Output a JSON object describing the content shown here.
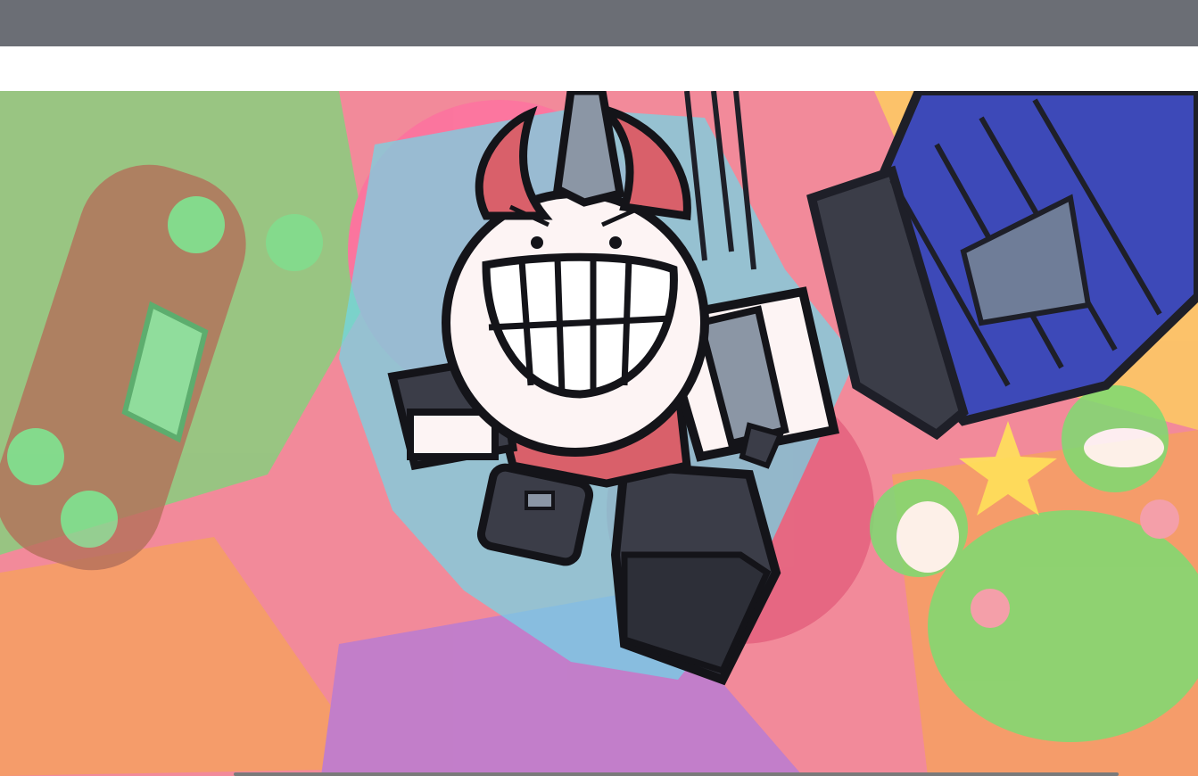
{
  "window": {
    "topbar_color": "#6b6e75",
    "page_background": "#ffffff"
  },
  "hero_banner": {
    "kind": "cartoon-illustration",
    "character": "horned-robot-mascot",
    "palette": {
      "pink": "#f07a8e",
      "cyan": "#5fd5e6",
      "green": "#6fd46a",
      "orange": "#f5a04a",
      "purple": "#b07ad8",
      "robot_body": "#fdf4f4",
      "robot_dark": "#3b3d48",
      "robot_red": "#d9606a",
      "robot_gray": "#8b96a5",
      "cannon_blue": "#3d49b8"
    }
  },
  "icons": [
    "grin-face-icon",
    "horn-icon",
    "frog-icon",
    "skateboard-icon",
    "star-icon",
    "speaker-cannon-icon"
  ]
}
